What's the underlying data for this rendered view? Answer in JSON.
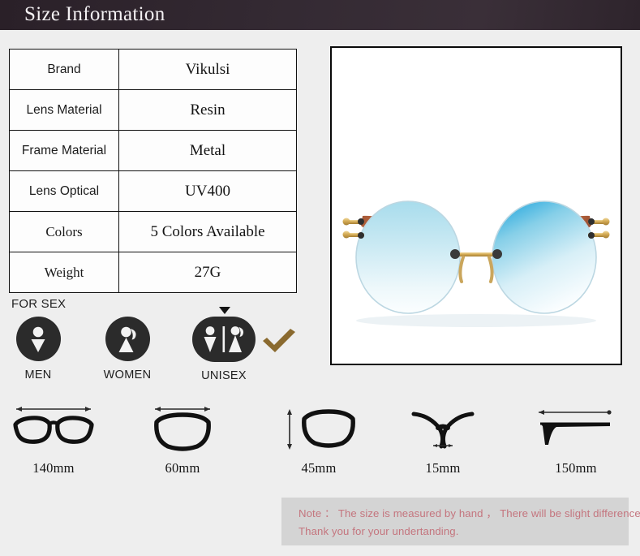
{
  "header": {
    "title": "Size Information"
  },
  "spec_table": {
    "rows": [
      {
        "key": "Brand",
        "value": "Vikulsi",
        "key_serif": false
      },
      {
        "key": "Lens Material",
        "value": "Resin",
        "key_serif": false
      },
      {
        "key": "Frame Material",
        "value": "Metal",
        "key_serif": false
      },
      {
        "key": "Lens Optical",
        "value": "UV400",
        "key_serif": false
      },
      {
        "key": "Colors",
        "value": "5 Colors Available",
        "key_serif": true
      },
      {
        "key": "Weight",
        "value": "27G",
        "key_serif": true
      }
    ]
  },
  "product_photo": {
    "alt": "rimless-oval-sunglasses-blue-gradient-lens-gold-frame-tortoise-temples"
  },
  "for_sex": {
    "label": "FOR SEX",
    "options": [
      {
        "id": "men",
        "label": "MEN",
        "icon": "male-figure-icon",
        "selected": false
      },
      {
        "id": "women",
        "label": "WOMEN",
        "icon": "female-figure-icon",
        "selected": false
      },
      {
        "id": "unisex",
        "label": "UNISEX",
        "icon": "unisex-figures-icon",
        "selected": true
      }
    ],
    "selected": "unisex",
    "selected_marker_icon": "down-triangle-pointer-icon",
    "check_icon": "check-mark-icon",
    "check_color": "#8a6a2f"
  },
  "measurements": [
    {
      "id": "frame-width",
      "value": "140mm",
      "icon": "full-glasses-front-with-width-arrow-icon"
    },
    {
      "id": "lens-width",
      "value": "60mm",
      "icon": "single-lens-with-width-arrow-icon"
    },
    {
      "id": "lens-height",
      "value": "45mm",
      "icon": "single-lens-with-height-arrow-icon"
    },
    {
      "id": "bridge-width",
      "value": "15mm",
      "icon": "bridge-with-width-arrow-icon"
    },
    {
      "id": "temple-length",
      "value": "150mm",
      "icon": "temple-arm-with-length-arrow-icon"
    }
  ],
  "note": {
    "line1": "Note ： The size is measured by hand ， There will be slight difference",
    "line2": "Thank you for your undertanding."
  },
  "colors": {
    "page_background": "#eeeeee",
    "banner": "#2e242c",
    "banner_text": "#f4f1f3",
    "table_border": "#111111",
    "table_background": "#fdfdfd",
    "icon_badge": "#2b2b2b",
    "note_background": "#d4d4d4",
    "note_text": "#c4757e"
  }
}
